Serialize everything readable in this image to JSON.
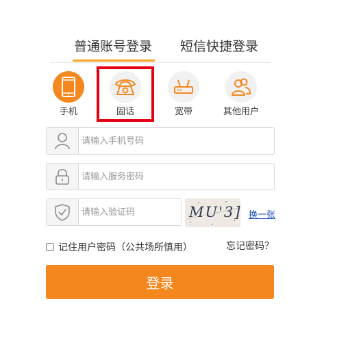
{
  "tabs": {
    "normal_login": "普通账号登录",
    "sms_login": "短信快捷登录",
    "active": "normal_login"
  },
  "login_types": [
    {
      "label": "手机",
      "icon": "mobile-phone-icon",
      "active": true
    },
    {
      "label": "固话",
      "icon": "landline-phone-icon",
      "active": false
    },
    {
      "label": "宽带",
      "icon": "router-icon",
      "active": false
    },
    {
      "label": "其他用户",
      "icon": "users-icon",
      "active": false
    }
  ],
  "form": {
    "phone_placeholder": "请输入手机号码",
    "password_placeholder": "请输入服务密码",
    "captcha_placeholder": "请输入验证码",
    "captcha_image_text": "MU'3]",
    "refresh_captcha": "换一张",
    "remember_label": "记住用户密码（公共场所慎用）",
    "forgot_password": "忘记密码？",
    "login_button": "登录"
  },
  "colors": {
    "accent": "#f5871f",
    "tab_underline": "#f5a623",
    "highlight_border": "#e60012",
    "link": "#1f4fb8"
  }
}
